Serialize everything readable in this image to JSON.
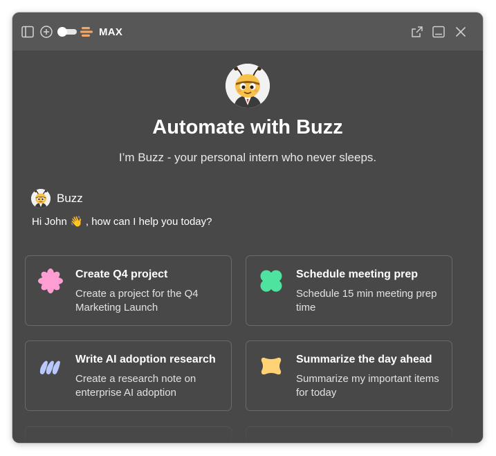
{
  "titlebar": {
    "mode_label": "MAX",
    "icons": [
      "sidebar-icon",
      "plus-circle-icon",
      "toggle-icon",
      "buzz-logo-icon",
      "open-external-icon",
      "minimize-panel-icon",
      "close-icon"
    ]
  },
  "hero": {
    "title": "Automate with Buzz",
    "subtitle": "I’m Buzz - your personal intern who never sleeps."
  },
  "message": {
    "sender": "Buzz",
    "text": "Hi John 👋 , how can I help you today?"
  },
  "cards": [
    {
      "title": "Create Q4 project",
      "desc": "Create a project for the Q4 Marketing Launch",
      "icon": "pink-flower-icon",
      "color": "#ff9ed2"
    },
    {
      "title": "Schedule meeting prep",
      "desc": "Schedule 15 min meeting prep time",
      "icon": "green-clover-icon",
      "color": "#4fe3a0"
    },
    {
      "title": "Write AI adoption research",
      "desc": "Create a research note on enterprise AI adoption",
      "icon": "blue-wave-icon",
      "color": "#b9c8ff"
    },
    {
      "title": "Summarize the day ahead",
      "desc": "Summarize my important items for today",
      "icon": "yellow-blob-icon",
      "color": "#ffd276"
    }
  ],
  "colors": {
    "window_bg": "#484848",
    "titlebar_bg": "#575757",
    "card_border": "#6a6a6a",
    "text_primary": "#ffffff"
  }
}
